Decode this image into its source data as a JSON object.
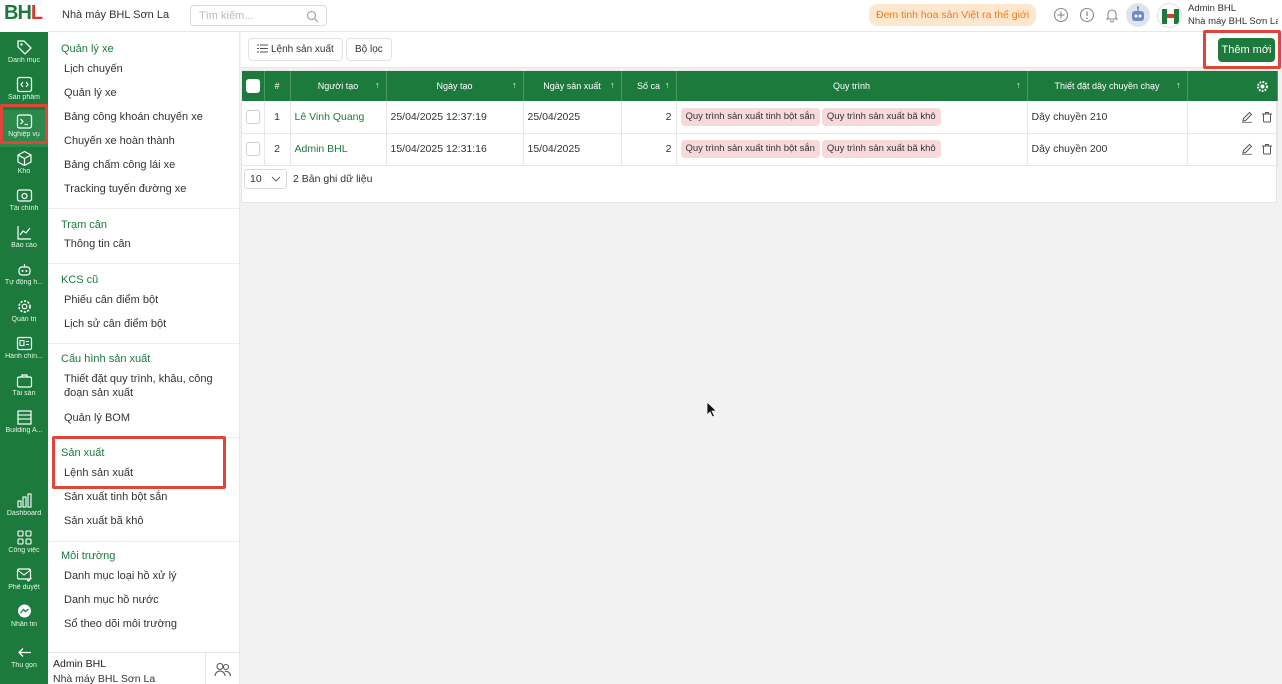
{
  "header": {
    "factory_name": "Nhà máy BHL Sơn La",
    "search_placeholder": "Tìm kiếm...",
    "slogan": "Đem tinh hoa sản Việt ra thế giới",
    "user_name": "Admin BHL",
    "user_factory": "Nhà máy BHL Sơn La",
    "logo_text_green": "BH",
    "logo_text_red": "L"
  },
  "rail": {
    "items": [
      {
        "label": "Danh mục",
        "icon": "tag-icon"
      },
      {
        "label": "Sản phẩm",
        "icon": "code-icon"
      },
      {
        "label": "Nghiệp vụ",
        "icon": "terminal-icon"
      },
      {
        "label": "Kho",
        "icon": "box-icon"
      },
      {
        "label": "Tài chính",
        "icon": "money-icon"
      },
      {
        "label": "Báo cáo",
        "icon": "chart-icon"
      },
      {
        "label": "Tự động h...",
        "icon": "robot-icon"
      },
      {
        "label": "Quản trị",
        "icon": "gear-icon"
      },
      {
        "label": "Hành chín...",
        "icon": "id-card-icon"
      },
      {
        "label": "Tài sản",
        "icon": "briefcase-icon"
      },
      {
        "label": "Building A...",
        "icon": "building-icon"
      },
      {
        "label": "Dashboard",
        "icon": "bar-chart-icon"
      },
      {
        "label": "Công việc",
        "icon": "grid-icon"
      },
      {
        "label": "Phê duyệt",
        "icon": "mail-check-icon"
      },
      {
        "label": "Nhắn tin",
        "icon": "messenger-icon"
      },
      {
        "label": "Thu gọn",
        "icon": "arrow-left-icon"
      }
    ]
  },
  "menu": {
    "sections": [
      {
        "title": "Quản lý xe",
        "items": [
          "Lịch chuyến",
          "Quản lý xe",
          "Bảng công khoán chuyến xe",
          "Chuyến xe hoàn thành",
          "Bảng chấm công lái xe",
          "Tracking tuyến đường xe"
        ]
      },
      {
        "title": "Trạm cân",
        "items": [
          "Thông tin cân"
        ]
      },
      {
        "title": "KCS cũ",
        "items": [
          "Phiếu cân điểm bột",
          "Lịch sử cân điểm bột"
        ]
      },
      {
        "title": "Cấu hình sản xuất",
        "items": [
          "Thiết đặt quy trình, khâu, công đoạn sản xuất",
          "Quản lý BOM"
        ]
      },
      {
        "title": "Sản xuất",
        "items": [
          "Lệnh sản xuất",
          "Sản xuất tinh bột sắn",
          "Sản xuất bã khô"
        ]
      },
      {
        "title": "Môi trường",
        "items": [
          "Danh mục loại hồ xử lý",
          "Danh mục hồ nước",
          "Sổ theo dõi môi trường"
        ]
      }
    ],
    "footer_name": "Admin BHL",
    "footer_factory": "Nhà máy BHL Sơn La"
  },
  "toolbar": {
    "tab_label": "Lệnh sản xuất",
    "filter_label": "Bộ lọc",
    "add_label": "Thêm mới"
  },
  "table": {
    "headers": [
      "#",
      "Người tạo",
      "Ngày tạo",
      "Ngày sản xuất",
      "Số ca",
      "Quy trình",
      "Thiết đặt dây chuyền chạy"
    ],
    "rows": [
      {
        "index": "1",
        "creator": "Lê Vinh Quang",
        "created": "25/04/2025 12:37:19",
        "production_date": "25/04/2025",
        "shifts": "2",
        "process_1": "Quy trình sản xuất tinh bột sắn",
        "process_2": "Quy trình sản xuất bã khô",
        "line": "Dây chuyền 210"
      },
      {
        "index": "2",
        "creator": "Admin BHL",
        "created": "15/04/2025 12:31:16",
        "production_date": "15/04/2025",
        "shifts": "2",
        "process_1": "Quy trình sản xuất tinh bột sắn",
        "process_2": "Quy trình sản xuất bã khô",
        "line": "Dây chuyền 200"
      }
    ],
    "page_size": "10",
    "records_text": "2 Bản ghi dữ liệu"
  },
  "colors": {
    "brand": "#1b7a3c",
    "highlight": "#e0453a",
    "tag_bg": "#f8d9d9"
  }
}
